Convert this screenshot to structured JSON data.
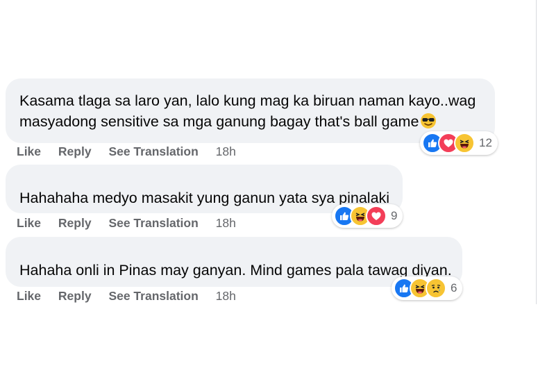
{
  "comments": [
    {
      "lines": [
        "Kasama tlaga sa laro yan, lalo kung mag ka biruan naman kayo..wag",
        "masyadong sensitive sa mga ganung bagay that's ball game"
      ],
      "trailing_emoji": "sunglasses-face",
      "actions": {
        "like": "Like",
        "reply": "Reply",
        "translate": "See Translation",
        "time": "18h"
      },
      "reactions": [
        "like",
        "love",
        "haha"
      ],
      "reaction_count": "12"
    },
    {
      "lines": [
        "Hahahaha medyo masakit yung ganun yata sya pinalaki"
      ],
      "actions": {
        "like": "Like",
        "reply": "Reply",
        "translate": "See Translation",
        "time": "18h"
      },
      "reactions": [
        "like",
        "haha",
        "love"
      ],
      "reaction_count": "9"
    },
    {
      "lines": [
        "Hahaha onli in Pinas may ganyan. Mind games pala tawag diyan."
      ],
      "actions": {
        "like": "Like",
        "reply": "Reply",
        "translate": "See Translation",
        "time": "18h"
      },
      "reactions": [
        "like",
        "haha",
        "sad"
      ],
      "reaction_count": "6"
    }
  ],
  "colors": {
    "bubble": "#f0f2f5",
    "action_text": "#65676b",
    "like": "#1877f2",
    "love": "#f33e58",
    "haha": "#f7c433"
  }
}
